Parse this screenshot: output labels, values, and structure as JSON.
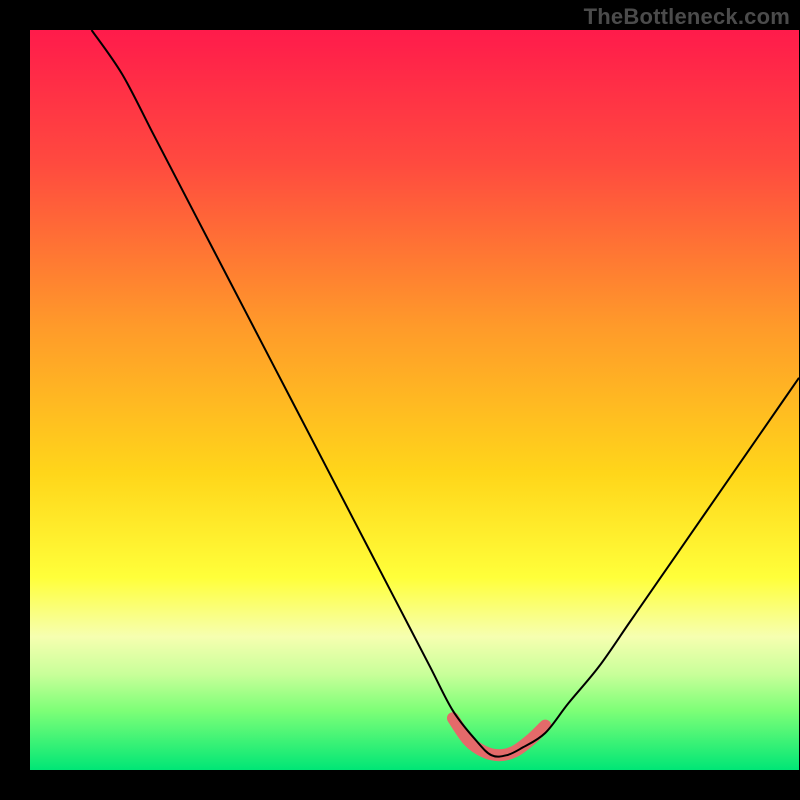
{
  "watermark": "TheBottleneck.com",
  "chart_data": {
    "type": "line",
    "title": "",
    "xlabel": "",
    "ylabel": "",
    "xlim": [
      0,
      100
    ],
    "ylim": [
      0,
      100
    ],
    "grid": false,
    "legend": false,
    "gradient_stops": [
      {
        "pct": 0,
        "color": "#ff1b4b"
      },
      {
        "pct": 18,
        "color": "#ff4a3f"
      },
      {
        "pct": 40,
        "color": "#ff9a2a"
      },
      {
        "pct": 60,
        "color": "#ffd61a"
      },
      {
        "pct": 74,
        "color": "#ffff3a"
      },
      {
        "pct": 82,
        "color": "#f6ffb0"
      },
      {
        "pct": 87,
        "color": "#c9ff9a"
      },
      {
        "pct": 92,
        "color": "#7dff77"
      },
      {
        "pct": 100,
        "color": "#00e676"
      }
    ],
    "series": [
      {
        "name": "bottleneck-curve",
        "x": [
          8,
          12,
          16,
          20,
          24,
          28,
          32,
          36,
          40,
          44,
          48,
          52,
          55,
          58,
          60,
          62,
          64,
          67,
          70,
          74,
          78,
          82,
          86,
          90,
          94,
          98,
          100
        ],
        "y": [
          100,
          94,
          86,
          78,
          70,
          62,
          54,
          46,
          38,
          30,
          22,
          14,
          8,
          4,
          2,
          2,
          3,
          5,
          9,
          14,
          20,
          26,
          32,
          38,
          44,
          50,
          53
        ]
      }
    ],
    "highlight": {
      "name": "optimal-zone",
      "x": [
        55,
        57,
        59,
        61,
        63,
        65,
        67
      ],
      "y": [
        7,
        4,
        2.5,
        2,
        2.5,
        4,
        6
      ],
      "color": "#e46a6a",
      "width": 12
    }
  }
}
